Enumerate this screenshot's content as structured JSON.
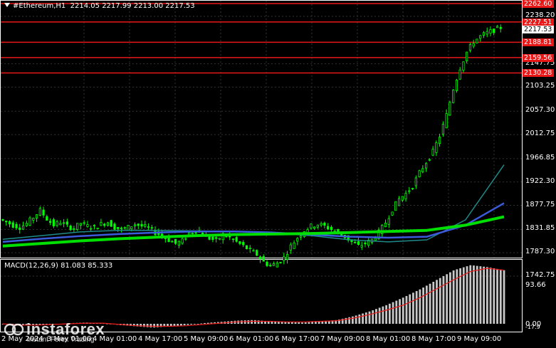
{
  "header": {
    "symbol": "#Ethereum,H1",
    "ohlc": "2214.05 2217.99 2213.00 2217.53"
  },
  "macd": {
    "label": "MACD(12,26,9) 81.083 85.333",
    "axis_top": "93.66",
    "axis_zero": "0.00",
    "axis_bottom": "-17.9"
  },
  "price_axis": [
    "2238.20",
    "2147.75",
    "2103.25",
    "2057.30",
    "2012.75",
    "1966.85",
    "1922.30",
    "1877.75",
    "1831.85",
    "1787.30",
    "1742.75"
  ],
  "level_boxes": [
    {
      "value": "2262.60",
      "color": "#e81818"
    },
    {
      "value": "2227.51",
      "color": "#e81818"
    },
    {
      "value": "2188.81",
      "color": "#e81818"
    },
    {
      "value": "2159.56",
      "color": "#e81818"
    },
    {
      "value": "2130.28",
      "color": "#e81818"
    }
  ],
  "current_price": "2217.53",
  "time_axis": [
    "2 May 2024",
    "3 May 01:00",
    "4 May 01:00",
    "4 May 17:00",
    "5 May 09:00",
    "6 May 01:00",
    "6 May 17:00",
    "7 May 09:00",
    "8 May 01:00",
    "8 May 17:00",
    "9 May 09:00"
  ],
  "logo": {
    "name": "instaforex",
    "tagline": "Instant Forex Trading"
  },
  "colors": {
    "background": "#000000",
    "candle_up": "#00ff00",
    "level_line": "#e81818",
    "ma_fast": "#00e000",
    "ma_mid": "#3b5bdb",
    "ma_slow": "#1f8a8a",
    "macd_hist": "#c8c8c8",
    "macd_signal": "#e81818"
  },
  "chart_data": {
    "type": "candlestick",
    "symbol": "#Ethereum",
    "timeframe": "H1",
    "x_range": [
      "2 May 2024",
      "9 May 09:00"
    ],
    "y_range": [
      1742.75,
      2262.6
    ],
    "price_path": [
      1851,
      1846,
      1840,
      1836,
      1843,
      1855,
      1868,
      1852,
      1840,
      1846,
      1838,
      1834,
      1844,
      1838,
      1836,
      1842,
      1846,
      1836,
      1832,
      1836,
      1842,
      1838,
      1835,
      1826,
      1820,
      1812,
      1805,
      1810,
      1825,
      1830,
      1822,
      1815,
      1810,
      1822,
      1816,
      1808,
      1800,
      1792,
      1784,
      1770,
      1762,
      1768,
      1778,
      1800,
      1816,
      1830,
      1838,
      1842,
      1838,
      1832,
      1826,
      1818,
      1808,
      1800,
      1805,
      1812,
      1826,
      1845,
      1870,
      1890,
      1900,
      1915,
      1940,
      1960,
      1980,
      2010,
      2050,
      2100,
      2140,
      2170,
      2190,
      2200,
      2207,
      2212,
      2217
    ],
    "ma_fast": [
      1800,
      1805,
      1810,
      1814,
      1817,
      1820,
      1822,
      1823,
      1824,
      1826,
      1828,
      1830,
      1840,
      1856
    ],
    "ma_mid": [
      1808,
      1814,
      1819,
      1823,
      1826,
      1828,
      1828,
      1826,
      1822,
      1818,
      1816,
      1818,
      1840,
      1882
    ],
    "ma_slow": [
      1813,
      1820,
      1827,
      1830,
      1830,
      1829,
      1828,
      1825,
      1820,
      1812,
      1808,
      1812,
      1850,
      1955
    ],
    "macd_hist": [
      0,
      -3,
      -2,
      -1,
      1,
      2,
      1,
      -2,
      -4,
      -6,
      -4,
      -2,
      1,
      3,
      5,
      6,
      4,
      3,
      2,
      4,
      6,
      12,
      20,
      30,
      42,
      55,
      70,
      85,
      93,
      90,
      85
    ],
    "macd_signal": [
      0,
      -2,
      -2,
      -1,
      0,
      1,
      1,
      -1,
      -3,
      -4,
      -4,
      -3,
      -1,
      1,
      3,
      4,
      4,
      3,
      3,
      4,
      5,
      9,
      15,
      22,
      30,
      42,
      56,
      70,
      83,
      88,
      85
    ]
  }
}
